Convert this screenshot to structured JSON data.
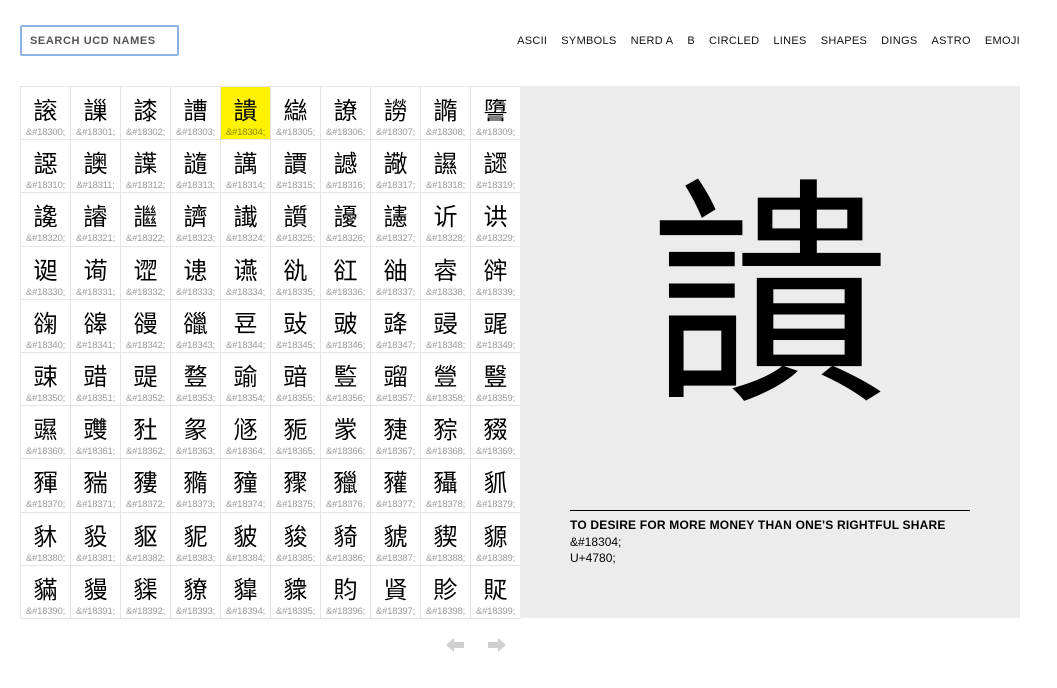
{
  "search": {
    "placeholder": "SEARCH UCD NAMES",
    "value": ""
  },
  "nav": [
    "ASCII",
    "SYMBOLS",
    "NERD A",
    "B",
    "CIRCLED",
    "LINES",
    "SHAPES",
    "DINGS",
    "ASTRO",
    "EMOJI"
  ],
  "grid": {
    "selected_index": 4,
    "cells": [
      {
        "g": "䜇",
        "c": "&#18300;"
      },
      {
        "g": "䜈",
        "c": "&#18301;"
      },
      {
        "g": "䜉",
        "c": "&#18302;"
      },
      {
        "g": "䜊",
        "c": "&#18303;"
      },
      {
        "g": "䜋",
        "c": "&#18304;"
      },
      {
        "g": "䜌",
        "c": "&#18305;"
      },
      {
        "g": "䜍",
        "c": "&#18306;"
      },
      {
        "g": "䜎",
        "c": "&#18307;"
      },
      {
        "g": "䜏",
        "c": "&#18308;"
      },
      {
        "g": "䜐",
        "c": "&#18309;"
      },
      {
        "g": "䜑",
        "c": "&#18310;"
      },
      {
        "g": "䜒",
        "c": "&#18311;"
      },
      {
        "g": "䜓",
        "c": "&#18312;"
      },
      {
        "g": "䜔",
        "c": "&#18313;"
      },
      {
        "g": "䜕",
        "c": "&#18314;"
      },
      {
        "g": "䜖",
        "c": "&#18315;"
      },
      {
        "g": "䜗",
        "c": "&#18316;"
      },
      {
        "g": "䜘",
        "c": "&#18317;"
      },
      {
        "g": "䜙",
        "c": "&#18318;"
      },
      {
        "g": "䜚",
        "c": "&#18319;"
      },
      {
        "g": "䜛",
        "c": "&#18320;"
      },
      {
        "g": "䜜",
        "c": "&#18321;"
      },
      {
        "g": "䜝",
        "c": "&#18322;"
      },
      {
        "g": "䜞",
        "c": "&#18323;"
      },
      {
        "g": "䜟",
        "c": "&#18324;"
      },
      {
        "g": "䜠",
        "c": "&#18325;"
      },
      {
        "g": "䜡",
        "c": "&#18326;"
      },
      {
        "g": "䜢",
        "c": "&#18327;"
      },
      {
        "g": "䜣",
        "c": "&#18328;"
      },
      {
        "g": "䜤",
        "c": "&#18329;"
      },
      {
        "g": "䜥",
        "c": "&#18330;"
      },
      {
        "g": "䜦",
        "c": "&#18331;"
      },
      {
        "g": "䜧",
        "c": "&#18332;"
      },
      {
        "g": "䜨",
        "c": "&#18333;"
      },
      {
        "g": "䜩",
        "c": "&#18334;"
      },
      {
        "g": "䜪",
        "c": "&#18335;"
      },
      {
        "g": "䜫",
        "c": "&#18336;"
      },
      {
        "g": "䜬",
        "c": "&#18337;"
      },
      {
        "g": "䜭",
        "c": "&#18338;"
      },
      {
        "g": "䜮",
        "c": "&#18339;"
      },
      {
        "g": "䜯",
        "c": "&#18340;"
      },
      {
        "g": "䜰",
        "c": "&#18341;"
      },
      {
        "g": "䜱",
        "c": "&#18342;"
      },
      {
        "g": "䜲",
        "c": "&#18343;"
      },
      {
        "g": "䜳",
        "c": "&#18344;"
      },
      {
        "g": "䜴",
        "c": "&#18345;"
      },
      {
        "g": "䜵",
        "c": "&#18346;"
      },
      {
        "g": "䜶",
        "c": "&#18347;"
      },
      {
        "g": "䜷",
        "c": "&#18348;"
      },
      {
        "g": "䜸",
        "c": "&#18349;"
      },
      {
        "g": "䜹",
        "c": "&#18350;"
      },
      {
        "g": "䜺",
        "c": "&#18351;"
      },
      {
        "g": "䜻",
        "c": "&#18352;"
      },
      {
        "g": "䜼",
        "c": "&#18353;"
      },
      {
        "g": "䜽",
        "c": "&#18354;"
      },
      {
        "g": "䜾",
        "c": "&#18355;"
      },
      {
        "g": "䜿",
        "c": "&#18356;"
      },
      {
        "g": "䝀",
        "c": "&#18357;"
      },
      {
        "g": "䝁",
        "c": "&#18358;"
      },
      {
        "g": "䝂",
        "c": "&#18359;"
      },
      {
        "g": "䝃",
        "c": "&#18360;"
      },
      {
        "g": "䝄",
        "c": "&#18361;"
      },
      {
        "g": "䝅",
        "c": "&#18362;"
      },
      {
        "g": "䝆",
        "c": "&#18363;"
      },
      {
        "g": "䝇",
        "c": "&#18364;"
      },
      {
        "g": "䝈",
        "c": "&#18365;"
      },
      {
        "g": "䝉",
        "c": "&#18366;"
      },
      {
        "g": "䝊",
        "c": "&#18367;"
      },
      {
        "g": "䝋",
        "c": "&#18368;"
      },
      {
        "g": "䝌",
        "c": "&#18369;"
      },
      {
        "g": "䝍",
        "c": "&#18370;"
      },
      {
        "g": "䝎",
        "c": "&#18371;"
      },
      {
        "g": "䝏",
        "c": "&#18372;"
      },
      {
        "g": "䝐",
        "c": "&#18373;"
      },
      {
        "g": "䝑",
        "c": "&#18374;"
      },
      {
        "g": "䝒",
        "c": "&#18375;"
      },
      {
        "g": "䝓",
        "c": "&#18376;"
      },
      {
        "g": "䝔",
        "c": "&#18377;"
      },
      {
        "g": "䝕",
        "c": "&#18378;"
      },
      {
        "g": "䝖",
        "c": "&#18379;"
      },
      {
        "g": "䝗",
        "c": "&#18380;"
      },
      {
        "g": "䝘",
        "c": "&#18381;"
      },
      {
        "g": "䝙",
        "c": "&#18382;"
      },
      {
        "g": "䝚",
        "c": "&#18383;"
      },
      {
        "g": "䝛",
        "c": "&#18384;"
      },
      {
        "g": "䝜",
        "c": "&#18385;"
      },
      {
        "g": "䝝",
        "c": "&#18386;"
      },
      {
        "g": "䝞",
        "c": "&#18387;"
      },
      {
        "g": "䝟",
        "c": "&#18388;"
      },
      {
        "g": "䝠",
        "c": "&#18389;"
      },
      {
        "g": "䝡",
        "c": "&#18390;"
      },
      {
        "g": "䝢",
        "c": "&#18391;"
      },
      {
        "g": "䝣",
        "c": "&#18392;"
      },
      {
        "g": "䝤",
        "c": "&#18393;"
      },
      {
        "g": "䝥",
        "c": "&#18394;"
      },
      {
        "g": "䝦",
        "c": "&#18395;"
      },
      {
        "g": "䝧",
        "c": "&#18396;"
      },
      {
        "g": "䝨",
        "c": "&#18397;"
      },
      {
        "g": "䝩",
        "c": "&#18398;"
      },
      {
        "g": "䝪",
        "c": "&#18399;"
      }
    ]
  },
  "preview": {
    "glyph": "䜋",
    "description": "TO DESIRE FOR MORE MONEY THAN ONE'S RIGHTFUL SHARE",
    "entity": "&#18304;",
    "unicode": "U+4780;"
  },
  "colors": {
    "highlight": "#fff200",
    "panel": "#ececec",
    "search_border": "#8fb3e0",
    "arrow": "#d0d0d0"
  },
  "pager": {
    "prev_icon": "arrow-left-icon",
    "next_icon": "arrow-right-icon"
  }
}
